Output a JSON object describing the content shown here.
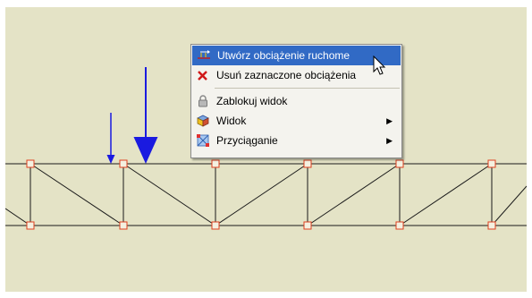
{
  "canvas": {
    "background_color": "#e4e3c6",
    "element_color": "#1a1a1a",
    "node_color": "#e04020",
    "load_color": "#1a1ae0"
  },
  "context_menu": {
    "items": [
      {
        "label": "Utwórz obciążenie ruchome",
        "icon": "moving-load-icon",
        "selected": true,
        "has_submenu": false
      },
      {
        "label": "Usuń zaznaczone obciążenia",
        "icon": "delete-x-icon",
        "selected": false,
        "has_submenu": false
      },
      {
        "label": "Zablokuj widok",
        "icon": "lock-icon",
        "selected": false,
        "has_submenu": false
      },
      {
        "label": "Widok",
        "icon": "view-cube-icon",
        "selected": false,
        "has_submenu": true
      },
      {
        "label": "Przyciąganie",
        "icon": "snap-icon",
        "selected": false,
        "has_submenu": true
      }
    ],
    "highlight_color": "#316ac5"
  },
  "cursor": {
    "icon": "arrow-cursor-icon"
  }
}
